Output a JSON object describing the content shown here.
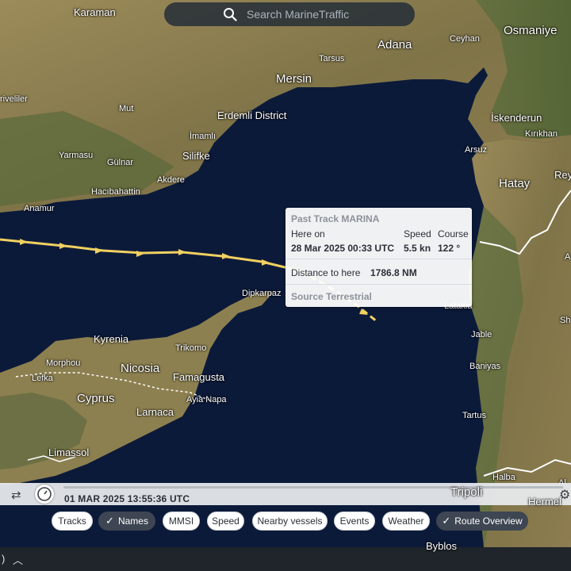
{
  "search": {
    "placeholder": "Search MarineTraffic"
  },
  "places": {
    "karaman": "Karaman",
    "adana": "Adana",
    "ceyhan": "Ceyhan",
    "osmaniye": "Osmaniye",
    "tarsus": "Tarsus",
    "mersin": "Mersin",
    "riveliler": "riveliler",
    "mut": "Mut",
    "erdemli": "Erdemli District",
    "iskenderun": "İskenderun",
    "kirikhan": "Kırıkhan",
    "imamli": "İmamlı",
    "yarmasu": "Yarmasu",
    "silifke": "Silifke",
    "arsuz": "Arsuz",
    "gulnar": "Gülnar",
    "akdere": "Akdere",
    "rey": "Rey",
    "hacibahattin": "Hacıbahattin",
    "hatay": "Hatay",
    "anamur": "Anamur",
    "dipkarpaz": "Dipkarpaz",
    "latakia": "Latakia",
    "jable": "Jable",
    "kyrenia": "Kyrenia",
    "trikomo": "Trikomo",
    "morphou": "Morphou",
    "nicosia": "Nicosia",
    "baniyas": "Baniyas",
    "lefka": "Lefka",
    "famagusta": "Famagusta",
    "cyprus": "Cyprus",
    "ayianapa": "Ayia Napa",
    "larnaca": "Larnaca",
    "tartus": "Tartus",
    "limassol": "Limassol",
    "halba": "Halba",
    "tripoli": "Tripoli",
    "hermel": "Hermel",
    "byblos": "Byblos",
    "sh": "Sh",
    "a": "A",
    "al": "Al"
  },
  "popup": {
    "title": "Past Track MARINA",
    "here_on_label": "Here on",
    "here_on_value": "28 Mar 2025 00:33 UTC",
    "speed_label": "Speed",
    "speed_value": "5.5 kn",
    "course_label": "Course",
    "course_value": "122 °",
    "distance_label": "Distance to here",
    "distance_value": "1786.8 NM",
    "source": "Source Terrestrial"
  },
  "timebar": {
    "timestamp": "01 MAR 2025 13:55:36 UTC"
  },
  "chips": {
    "tracks": "Tracks",
    "names": "Names",
    "mmsi": "MMSI",
    "speed": "Speed",
    "nearby": "Nearby vessels",
    "events": "Events",
    "weather": "Weather",
    "route_overview": "Route Overview"
  },
  "colors": {
    "track": "#f0d060",
    "sea": "#0c1a3a",
    "land": "#8a7a4e"
  },
  "bottom": {
    "left_text": ")"
  }
}
